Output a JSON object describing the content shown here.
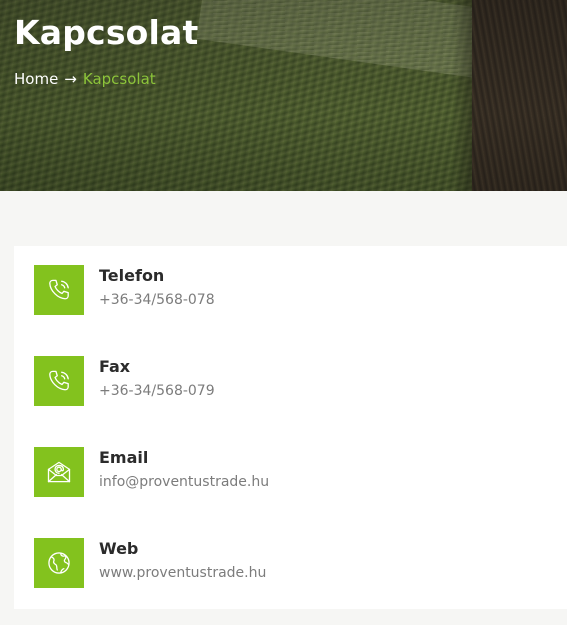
{
  "header": {
    "title": "Kapcsolat",
    "breadcrumb": {
      "home": "Home",
      "separator": "→",
      "current": "Kapcsolat"
    }
  },
  "contacts": [
    {
      "icon": "phone-icon",
      "title": "Telefon",
      "value": "+36-34/568-078"
    },
    {
      "icon": "phone-icon",
      "title": "Fax",
      "value": "+36-34/568-079"
    },
    {
      "icon": "envelope-icon",
      "title": "Email",
      "value": "info@proventustrade.hu"
    },
    {
      "icon": "globe-icon",
      "title": "Web",
      "value": "www.proventustrade.hu"
    }
  ],
  "colors": {
    "accent": "#83c21e",
    "breadcrumb_active": "#8cc43a",
    "page_background": "#f6f6f4",
    "card_background": "#ffffff"
  }
}
